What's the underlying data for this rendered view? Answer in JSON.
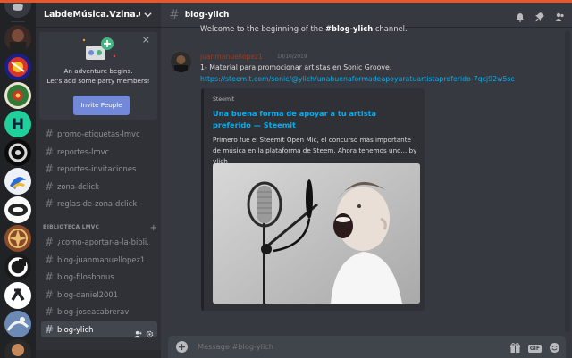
{
  "colors": {
    "accent": "#e8562a",
    "blurple": "#7289da",
    "link": "#00b0f4",
    "author": "#a63a1e"
  },
  "servers": [
    {
      "name": "discord-home-icon"
    },
    {
      "name": "server-avatar-1"
    },
    {
      "name": "server-avatar-2"
    },
    {
      "name": "server-avatar-3"
    },
    {
      "name": "server-h"
    },
    {
      "name": "server-avatar-5"
    },
    {
      "name": "server-avatar-6"
    },
    {
      "name": "server-avatar-7"
    },
    {
      "name": "server-avatar-8"
    },
    {
      "name": "server-avatar-9"
    },
    {
      "name": "server-avatar-10"
    },
    {
      "name": "server-avatar-11"
    },
    {
      "name": "server-avatar-12"
    }
  ],
  "guild": {
    "name": "LabdeMúsica.Vzlna.Cont...",
    "chevron_icon": "chevron-down-icon"
  },
  "invite": {
    "line1": "An adventure begins.",
    "line2": "Let's add some party members!",
    "button": "Invite People",
    "close": "×"
  },
  "channels": [
    {
      "label": "promo-etiquetas-lmvc"
    },
    {
      "label": "reportes-lmvc"
    },
    {
      "label": "reportes-invitaciones"
    },
    {
      "label": "zona-dclick"
    },
    {
      "label": "reglas-de-zona-dclick"
    }
  ],
  "category": {
    "label": "BIBLIOTECA LMVC",
    "add": "+"
  },
  "library_channels": [
    {
      "label": "¿como-aportar-a-la-bibli..."
    },
    {
      "label": "blog-juanmanuellopez1"
    },
    {
      "label": "blog-filosbonus"
    },
    {
      "label": "blog-daniel2001"
    },
    {
      "label": "blog-joseacabrerav"
    },
    {
      "label": "blog-ylich"
    }
  ],
  "header": {
    "hash": "#",
    "channel": "blog-ylich",
    "icons": [
      "bell-icon",
      "pin-icon",
      "members-icon"
    ]
  },
  "welcome": {
    "prefix": "Welcome to the beginning of the ",
    "channel": "#blog-ylich",
    "suffix": " channel."
  },
  "message": {
    "author": "juanmanuellopez1",
    "timestamp": "10/10/2019",
    "text": "1- Material para promocionar artistas en Sonic Groove.",
    "link": "https://steemit.com/sonic/@ylich/unabuenaformadeapoyaratuartistapreferido-7qcj92w5sc"
  },
  "embed": {
    "provider": "Steemit",
    "title": "Una buena forma de apoyar a tu artista preferido — Steemit",
    "description": "Primero fue el Steemit Open Mic, el concurso más importante de música en la plataforma de Steem. Ahora tenemos uno... by ylich",
    "image": "boy-shouting-into-microphone"
  },
  "composer": {
    "placeholder": "Message #blog-ylich",
    "add": "+",
    "gif": "GIF",
    "icons": [
      "gift-icon",
      "gif-icon",
      "emoji-icon"
    ]
  }
}
